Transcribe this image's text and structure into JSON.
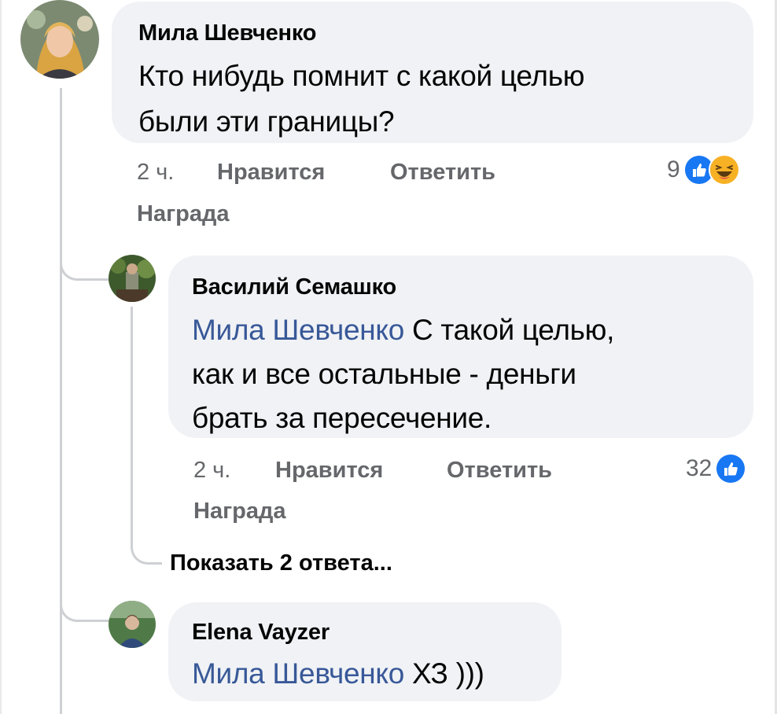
{
  "comments": [
    {
      "author": "Мила Шевченко",
      "text_lines": [
        "Кто нибудь помнит с какой целью",
        "были эти границы?"
      ],
      "time": "2 ч.",
      "like_label": "Нравится",
      "reply_label": "Ответить",
      "award_label": "Награда",
      "reaction_count": "9",
      "reactions": [
        "like-icon",
        "haha-icon"
      ]
    },
    {
      "author": "Василий Семашко",
      "mention": "Мила Шевченко",
      "text_first": "С такой целью,",
      "text_lines": [
        "как и все остальные - деньги",
        "брать за пересечение."
      ],
      "time": "2 ч.",
      "like_label": "Нравится",
      "reply_label": "Ответить",
      "award_label": "Награда",
      "reaction_count": "32",
      "reactions": [
        "like-icon"
      ]
    },
    {
      "author": "Elena Vayzer",
      "mention": "Мила Шевченко",
      "text": "ХЗ )))"
    }
  ],
  "show_replies_label": "Показать 2 ответа...",
  "colors": {
    "bubble": "#f0f2f5",
    "mention": "#385898",
    "secondary_text": "#65676b",
    "like_blue": "#1877f2",
    "haha_yellow": "#f7b125",
    "thread_line": "#ced0d4"
  }
}
